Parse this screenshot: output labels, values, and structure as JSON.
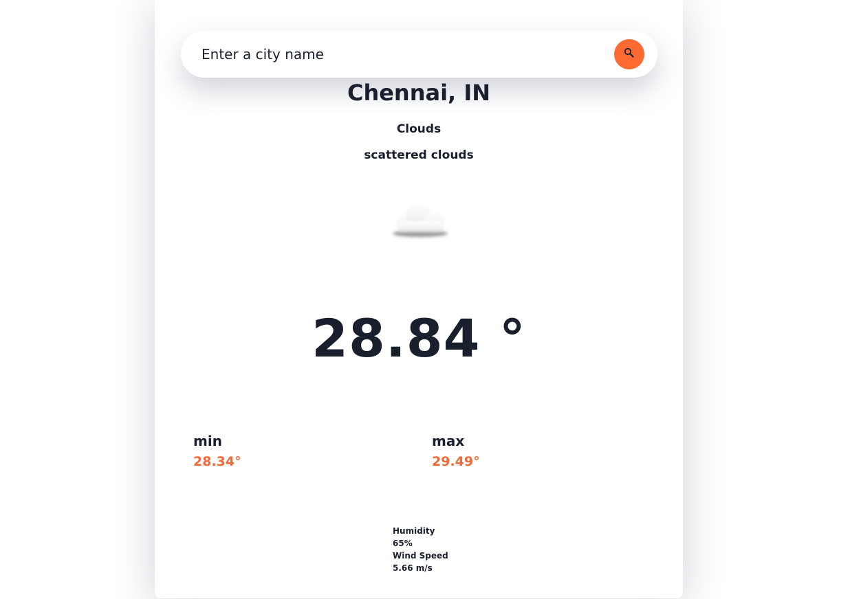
{
  "search": {
    "placeholder": "Enter a city name",
    "icon": "search-icon"
  },
  "location": {
    "city": "Chennai, IN"
  },
  "condition": {
    "main": "Clouds",
    "description": "scattered clouds",
    "icon": "cloud-icon"
  },
  "temperature": {
    "current": "28.84 °"
  },
  "range": {
    "min_label": "min",
    "min_value": "28.34°",
    "max_label": "max",
    "max_value": "29.49°"
  },
  "details": {
    "humidity_label": "Humidity",
    "humidity_value": "65%",
    "wind_label": "Wind Speed",
    "wind_value": "5.66 m/s"
  },
  "colors": {
    "accent": "#ff6a33",
    "text": "#1a1f2e",
    "range_value": "#f26a38"
  }
}
